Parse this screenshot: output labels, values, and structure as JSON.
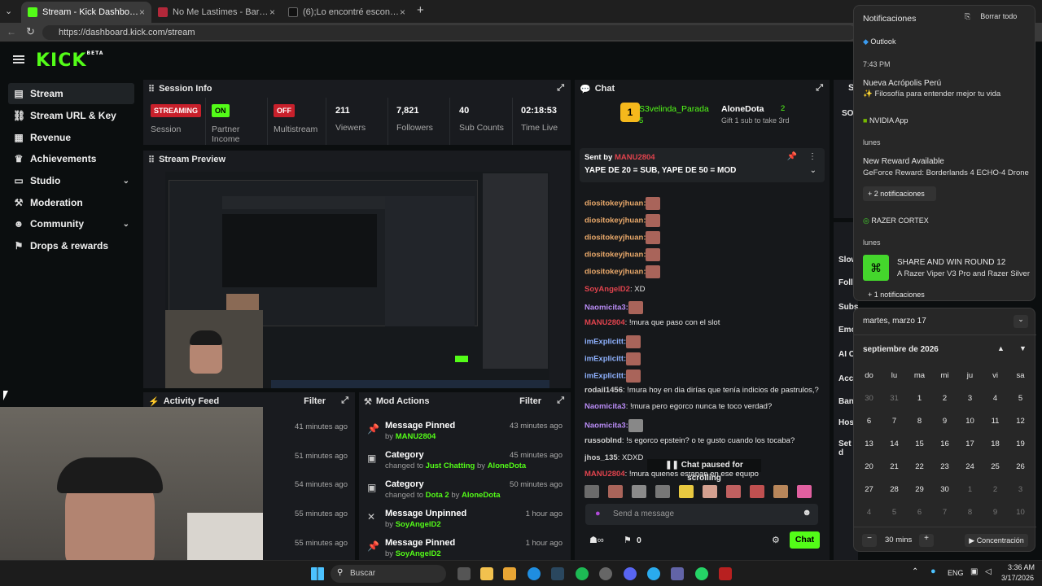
{
  "browser": {
    "tabs": [
      {
        "label": "Stream - Kick Dashboard",
        "fav": "#53fc18",
        "active": true
      },
      {
        "label": "No Me Lastimes - Barbaro Fines y...",
        "fav": "#b2283a",
        "active": false
      },
      {
        "label": "(6);Lo encontré escondido abajo d...",
        "fav": "#111111",
        "active": false
      }
    ],
    "url": "https://dashboard.kick.com/stream",
    "new_tab": "+"
  },
  "logo": {
    "text": "KICK",
    "beta": "BETA"
  },
  "sidebar": {
    "items": [
      {
        "label": "Stream",
        "icon": "play-icon"
      },
      {
        "label": "Stream URL & Key",
        "icon": "link-icon"
      },
      {
        "label": "Revenue",
        "icon": "revenue-icon"
      },
      {
        "label": "Achievements",
        "icon": "trophy-icon"
      },
      {
        "label": "Studio",
        "icon": "studio-icon"
      },
      {
        "label": "Moderation",
        "icon": "hammer-icon"
      },
      {
        "label": "Community",
        "icon": "community-icon"
      },
      {
        "label": "Drops & rewards",
        "icon": "gift-icon"
      }
    ]
  },
  "session": {
    "title": "Session Info",
    "streaming": "STREAMING",
    "session_label": "Session",
    "on": "ON",
    "partner_label": "Partner Income",
    "off": "OFF",
    "multistream_label": "Multistream",
    "viewers": "211",
    "viewers_label": "Viewers",
    "followers": "7,821",
    "followers_label": "Followers",
    "subs": "40",
    "subs_label": "Sub Counts",
    "time": "02:18:53",
    "time_label": "Time Live"
  },
  "preview": {
    "title": "Stream Preview"
  },
  "activity": {
    "title": "Activity Feed",
    "filter": "Filter",
    "times": [
      "41 minutes ago",
      "51 minutes ago",
      "54 minutes ago",
      "55 minutes ago",
      "55 minutes ago"
    ]
  },
  "mod": {
    "title": "Mod Actions",
    "filter": "Filter",
    "rows": [
      {
        "action": "Message Pinned",
        "detail": "by",
        "who": "MANU2804",
        "extra": "",
        "extra2": "",
        "time": "43 minutes ago",
        "icon": "pin-icon"
      },
      {
        "action": "Category",
        "detail": "changed to",
        "who": "Just Chatting",
        "extra": "by",
        "extra2": "AloneDota",
        "time": "45 minutes ago",
        "icon": "category-icon"
      },
      {
        "action": "Category",
        "detail": "changed to",
        "who": "Dota 2",
        "extra": "by",
        "extra2": "AloneDota",
        "time": "50 minutes ago",
        "icon": "category-icon"
      },
      {
        "action": "Message Unpinned",
        "detail": "by",
        "who": "SoyAngelD2",
        "extra": "",
        "extra2": "",
        "time": "1 hour ago",
        "icon": "unpin-icon"
      },
      {
        "action": "Message Pinned",
        "detail": "by",
        "who": "SoyAngelD2",
        "extra": "",
        "extra2": "",
        "time": "1 hour ago",
        "icon": "pin-icon"
      }
    ]
  },
  "chat": {
    "title": "Chat",
    "leader1": "S3velinda_Parada",
    "leader1_count": "5",
    "leader2": "AloneDota",
    "leader2_count": "2",
    "leader2_sub": "Gift 1 sub to take 3rd",
    "pinned_by": "Sent by",
    "pinned_user": "MANU2804",
    "pinned_msg": "YAPE DE 20 = SUB, YAPE DE 50 = MOD",
    "lines": [
      {
        "user": "diositokeyjhuan:",
        "color": "#e8a86a",
        "msg": ""
      },
      {
        "user": "diositokeyjhuan:",
        "color": "#e8a86a",
        "msg": ""
      },
      {
        "user": "diositokeyjhuan:",
        "color": "#e8a86a",
        "msg": ""
      },
      {
        "user": "diositokeyjhuan:",
        "color": "#e8a86a",
        "msg": ""
      },
      {
        "user": "diositokeyjhuan:",
        "color": "#e8a86a",
        "msg": ""
      },
      {
        "user": "SoyAngelD2",
        "color": "#e0434d",
        "msg": ": XD"
      },
      {
        "user": "Naomicita3:",
        "color": "#b98cf5",
        "msg": ""
      },
      {
        "user": "MANU2804",
        "color": "#e0434d",
        "msg": ": !mura que paso con el slot"
      },
      {
        "user": "imExplicitt:",
        "color": "#8fb2ff",
        "msg": ""
      },
      {
        "user": "imExplicitt:",
        "color": "#8fb2ff",
        "msg": ""
      },
      {
        "user": "imExplicitt:",
        "color": "#8fb2ff",
        "msg": ""
      },
      {
        "user": "rodail1456",
        "color": "#cfcfcf",
        "msg": ": !mura hoy en dia dirías que tenía indicios de pastrulos,?"
      },
      {
        "user": "Naomicita3",
        "color": "#b98cf5",
        "msg": ": !mura pero egorco nunca te toco verdad?"
      },
      {
        "user": "Naomicita3:",
        "color": "#b98cf5",
        "msg": ""
      },
      {
        "user": "russobInd",
        "color": "#cfcfcf",
        "msg": ": !s egorco epstein? o te gusto cuando los tocaba?"
      },
      {
        "user": "jhos_135",
        "color": "#cfcfcf",
        "msg": ": XDXD"
      },
      {
        "user": "MANU2804",
        "color": "#e0434d",
        "msg": ": !mura quienes estaban en ese equipo"
      }
    ],
    "paused": "Chat paused for scrolling",
    "placeholder": "Send a message",
    "count": "0",
    "send": "Chat"
  },
  "notifications": {
    "title": "Notificaciones",
    "clear": "Borrar todo",
    "outlook": "Outlook",
    "time": "7:43 PM",
    "n1_title": "Nueva Acrópolis Perú",
    "n1_body": "✨ Filosofía para entender mejor tu vida",
    "nvidia": "NVIDIA App",
    "lunes": "lunes",
    "n2_title": "New Reward Available",
    "n2_body": "GeForce Reward: Borderlands 4 ECHO-4 Drone",
    "n2_more": "+ 2 notificaciones",
    "razer": "RAZER CORTEX",
    "n3_title": "SHARE AND WIN ROUND 12",
    "n3_body": "A Razer Viper V3 Pro and Razer Silver",
    "n3_more": "+ 1 notificaciones"
  },
  "calendar": {
    "date": "martes, marzo 17",
    "month": "septiembre de 2026",
    "weekdays": [
      "do",
      "lu",
      "ma",
      "mi",
      "ju",
      "vi",
      "sa"
    ],
    "weeks": [
      [
        "30",
        "31",
        "1",
        "2",
        "3",
        "4",
        "5"
      ],
      [
        "6",
        "7",
        "8",
        "9",
        "10",
        "11",
        "12"
      ],
      [
        "13",
        "14",
        "15",
        "16",
        "17",
        "18",
        "19"
      ],
      [
        "20",
        "21",
        "22",
        "23",
        "24",
        "25",
        "26"
      ],
      [
        "27",
        "28",
        "29",
        "30",
        "1",
        "2",
        "3"
      ],
      [
        "4",
        "5",
        "6",
        "7",
        "8",
        "9",
        "10"
      ]
    ],
    "focus_minus": "−",
    "focus_time": "30 mins",
    "focus_plus": "+",
    "focus_btn": "Concentración"
  },
  "right_partial": {
    "labels": [
      "Slow",
      "Follo",
      "Subs",
      "Emo",
      "AI C",
      "Acco",
      "Bann",
      "Host",
      "Set d"
    ],
    "s": "S",
    "so": "SO"
  },
  "taskbar": {
    "search": "Buscar",
    "lang": "ENG",
    "time": "3:36 AM",
    "date": "3/17/2026"
  }
}
